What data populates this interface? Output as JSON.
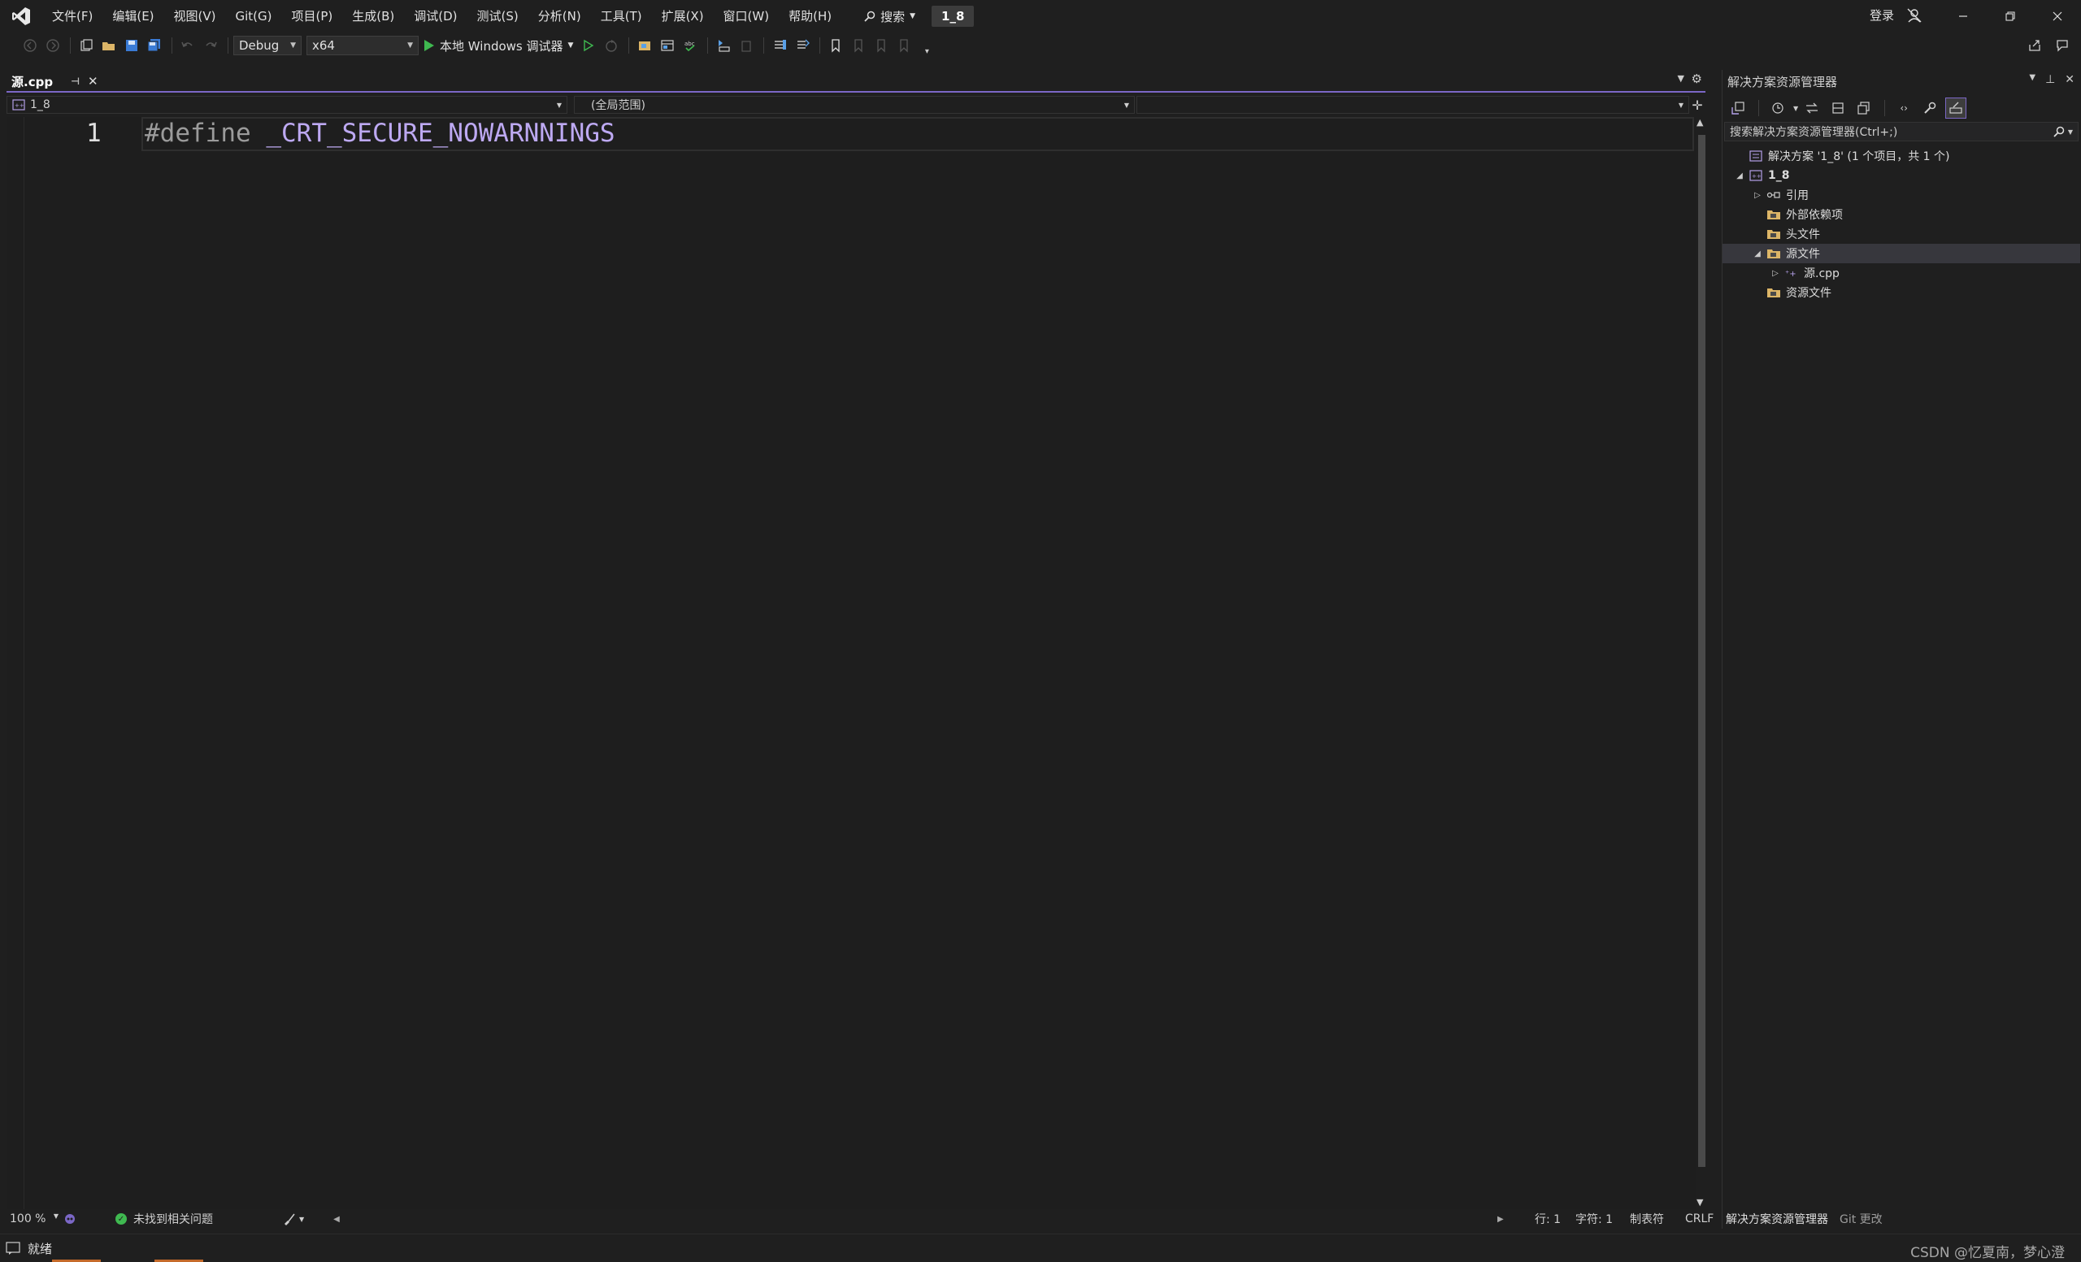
{
  "app": {
    "menu": [
      "文件(F)",
      "编辑(E)",
      "视图(V)",
      "Git(G)",
      "项目(P)",
      "生成(B)",
      "调试(D)",
      "测试(S)",
      "分析(N)",
      "工具(T)",
      "扩展(X)",
      "窗口(W)",
      "帮助(H)"
    ],
    "search_label": "搜索",
    "solution_name": "1_8",
    "login_label": "登录"
  },
  "toolbar": {
    "configuration": "Debug",
    "platform": "x64",
    "run_label": "本地 Windows 调试器"
  },
  "editor": {
    "tab_name": "源.cpp",
    "nav_project": "1_8",
    "nav_scope": "(全局范围)",
    "nav_member": "",
    "line_number": "1",
    "code_directive": "#define",
    "code_macro": "_CRT_SECURE_NOWARNNINGS",
    "zoom": "100 %",
    "issues": "未找到相关问题",
    "line": "行: 1",
    "char": "字符: 1",
    "indent": "制表符",
    "eol": "CRLF"
  },
  "solution_explorer": {
    "title": "解决方案资源管理器",
    "search_placeholder": "搜索解决方案资源管理器(Ctrl+;)",
    "tree": [
      {
        "label": "解决方案 '1_8' (1 个项目，共 1 个)",
        "icon": "solution-icon",
        "arrow": ""
      },
      {
        "label": "1_8",
        "icon": "project-icon",
        "arrow": "expanded"
      },
      {
        "label": "引用",
        "icon": "references-icon",
        "arrow": "collapsed"
      },
      {
        "label": "外部依赖项",
        "icon": "folder-filter-icon",
        "arrow": ""
      },
      {
        "label": "头文件",
        "icon": "folder-filter-icon",
        "arrow": ""
      },
      {
        "label": "源文件",
        "icon": "folder-filter-icon",
        "arrow": "expanded",
        "selected": true
      },
      {
        "label": "源.cpp",
        "icon": "cpp-file-icon",
        "arrow": "collapsed"
      },
      {
        "label": "资源文件",
        "icon": "folder-filter-icon",
        "arrow": ""
      }
    ],
    "bottom_tabs": [
      "解决方案资源管理器",
      "Git 更改"
    ]
  },
  "status": {
    "ready": "就绪",
    "right_text": "CSDN @忆夏南，梦心澄"
  },
  "colors": {
    "accent": "#7b67c6",
    "macro": "#bda9f2",
    "directive": "#9b9b9b",
    "run_green": "#3fb950"
  }
}
